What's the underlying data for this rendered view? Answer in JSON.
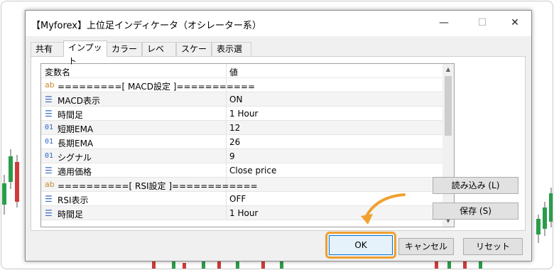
{
  "window": {
    "title": "【Myforex】上位足インディケータ（オシレーター系）",
    "minimize_icon": "minimize-icon",
    "maximize_icon": "maximize-icon",
    "close_icon": "close-icon"
  },
  "tabs": [
    {
      "label": "共有"
    },
    {
      "label": "インプット"
    },
    {
      "label": "カラー"
    },
    {
      "label": "レベル"
    },
    {
      "label": "スケール"
    },
    {
      "label": "表示選択"
    }
  ],
  "active_tab": "インプット",
  "grid": {
    "headers": {
      "name": "変数名",
      "value": "値"
    },
    "rows": [
      {
        "icon": "ab",
        "name": "=========[ MACD設定 ]===========",
        "value": ""
      },
      {
        "icon": "list",
        "name": "MACD表示",
        "value": "ON"
      },
      {
        "icon": "list",
        "name": "時間足",
        "value": "1 Hour"
      },
      {
        "icon": "01",
        "name": "短期EMA",
        "value": "12"
      },
      {
        "icon": "01",
        "name": "長期EMA",
        "value": "26"
      },
      {
        "icon": "01",
        "name": "シグナル",
        "value": "9"
      },
      {
        "icon": "list",
        "name": "適用価格",
        "value": "Close price"
      },
      {
        "icon": "ab",
        "name": "==========[ RSI設定 ]============",
        "value": ""
      },
      {
        "icon": "list",
        "name": "RSI表示",
        "value": "OFF"
      },
      {
        "icon": "list",
        "name": "時間足",
        "value": "1 Hour"
      }
    ]
  },
  "side_buttons": {
    "load": "読み込み (L)",
    "save": "保存 (S)"
  },
  "footer_buttons": {
    "ok": "OK",
    "cancel": "キャンセル",
    "reset": "リセット"
  },
  "colors": {
    "highlight": "#f0a030",
    "ok_border": "#0078d7",
    "candle_up": "#2a9d4a",
    "candle_down": "#d03a3a"
  }
}
